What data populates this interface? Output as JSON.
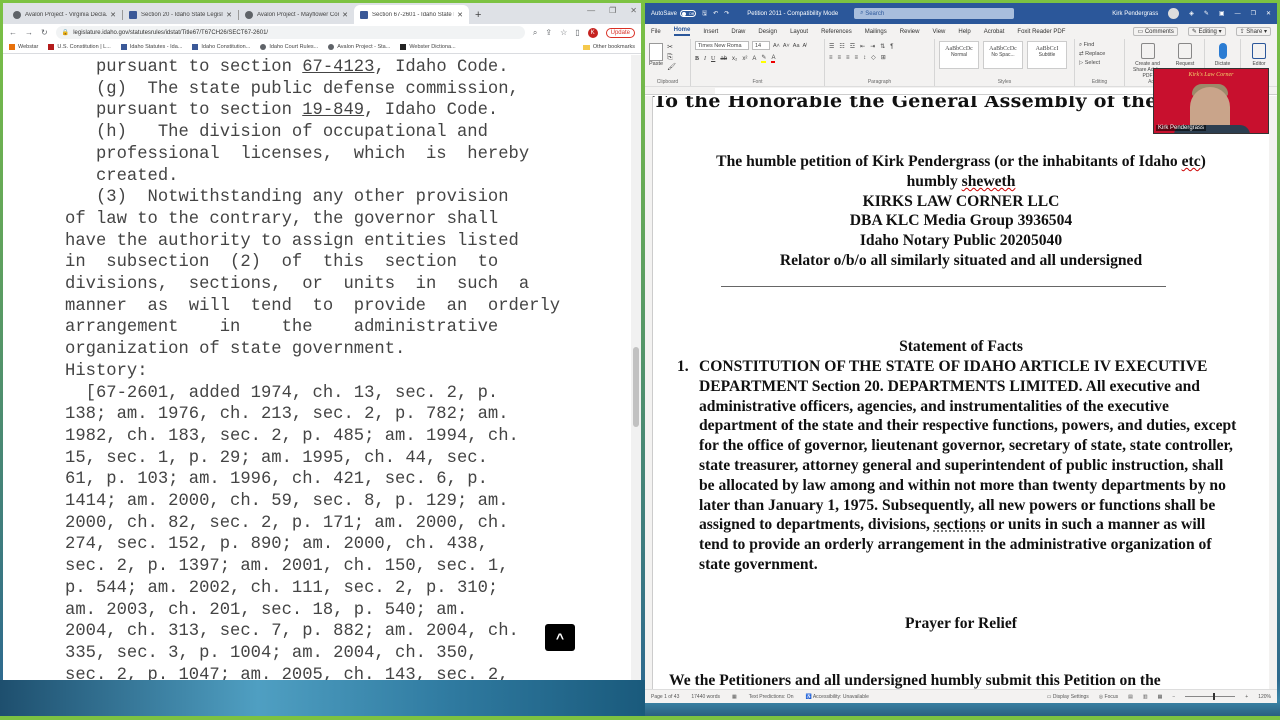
{
  "browser": {
    "tabs": [
      {
        "title": "Avalon Project - Virginia Decla...",
        "active": false
      },
      {
        "title": "Section 20 - Idaho State Legisla...",
        "active": false
      },
      {
        "title": "Avalon Project - Mayflower Com...",
        "active": false
      },
      {
        "title": "Section 67-2601 - Idaho State Le...",
        "active": true
      }
    ],
    "new_tab_label": "+",
    "url": "legislature.idaho.gov/statutesrules/idstat/Title67/T67CH26/SECT67-2601/",
    "profile_initial": "K",
    "update_label": "Update",
    "bookmarks": [
      {
        "label": "Webstar"
      },
      {
        "label": "U.S. Constitution | L..."
      },
      {
        "label": "Idaho Statutes - Ida..."
      },
      {
        "label": "Idaho Constitution..."
      },
      {
        "label": "Idaho Court Rules..."
      },
      {
        "label": "Avalon Project - Sta..."
      },
      {
        "label": "Webster Dictiona..."
      }
    ],
    "other_bookmarks_label": "Other bookmarks",
    "page": {
      "lines": [
        {
          "indent": "   ",
          "pre": "pursuant to section ",
          "link": "67-4123",
          "post": ", Idaho Code."
        },
        {
          "indent": "   ",
          "pre": "(g)  The state public defense commission,",
          "link": "",
          "post": ""
        },
        {
          "indent": "   ",
          "pre": "pursuant to section ",
          "link": "19-849",
          "post": ", Idaho Code."
        },
        {
          "indent": "   ",
          "pre": "(h)   The division of occupational and",
          "link": "",
          "post": ""
        },
        {
          "indent": "   ",
          "pre": "professional  licenses,  which  is  hereby",
          "link": "",
          "post": ""
        },
        {
          "indent": "   ",
          "pre": "created.",
          "link": "",
          "post": ""
        },
        {
          "indent": "   ",
          "pre": "(3)  Notwithstanding any other provision",
          "link": "",
          "post": ""
        },
        {
          "indent": "",
          "pre": "of law to the contrary, the governor shall",
          "link": "",
          "post": ""
        },
        {
          "indent": "",
          "pre": "have the authority to assign entities listed",
          "link": "",
          "post": ""
        },
        {
          "indent": "",
          "pre": "in  subsection  (2)  of  this  section  to",
          "link": "",
          "post": ""
        },
        {
          "indent": "",
          "pre": "divisions,  sections,  or  units  in  such  a",
          "link": "",
          "post": ""
        },
        {
          "indent": "",
          "pre": "manner  as  will  tend  to  provide  an  orderly",
          "link": "",
          "post": ""
        },
        {
          "indent": "",
          "pre": "arrangement    in    the    administrative",
          "link": "",
          "post": ""
        },
        {
          "indent": "",
          "pre": "organization of state government.",
          "link": "",
          "post": ""
        },
        {
          "indent": "",
          "pre": "History:",
          "link": "",
          "post": ""
        },
        {
          "indent": "  ",
          "pre": "[67-2601, added 1974, ch. 13, sec. 2, p.",
          "link": "",
          "post": ""
        },
        {
          "indent": "",
          "pre": "138; am. 1976, ch. 213, sec. 2, p. 782; am.",
          "link": "",
          "post": ""
        },
        {
          "indent": "",
          "pre": "1982, ch. 183, sec. 2, p. 485; am. 1994, ch.",
          "link": "",
          "post": ""
        },
        {
          "indent": "",
          "pre": "15, sec. 1, p. 29; am. 1995, ch. 44, sec.",
          "link": "",
          "post": ""
        },
        {
          "indent": "",
          "pre": "61, p. 103; am. 1996, ch. 421, sec. 6, p.",
          "link": "",
          "post": ""
        },
        {
          "indent": "",
          "pre": "1414; am. 2000, ch. 59, sec. 8, p. 129; am.",
          "link": "",
          "post": ""
        },
        {
          "indent": "",
          "pre": "2000, ch. 82, sec. 2, p. 171; am. 2000, ch.",
          "link": "",
          "post": ""
        },
        {
          "indent": "",
          "pre": "274, sec. 152, p. 890; am. 2000, ch. 438,",
          "link": "",
          "post": ""
        },
        {
          "indent": "",
          "pre": "sec. 2, p. 1397; am. 2001, ch. 150, sec. 1,",
          "link": "",
          "post": ""
        },
        {
          "indent": "",
          "pre": "p. 544; am. 2002, ch. 111, sec. 2, p. 310;",
          "link": "",
          "post": ""
        },
        {
          "indent": "",
          "pre": "am. 2003, ch. 201, sec. 18, p. 540; am.",
          "link": "",
          "post": ""
        },
        {
          "indent": "",
          "pre": "2004, ch. 313, sec. 7, p. 882; am. 2004, ch.",
          "link": "",
          "post": ""
        },
        {
          "indent": "",
          "pre": "335, sec. 3, p. 1004; am. 2004, ch. 350,",
          "link": "",
          "post": ""
        },
        {
          "indent": "",
          "pre": "sec. 2, p. 1047; am. 2005, ch. 143, sec. 2,",
          "link": "",
          "post": ""
        }
      ],
      "back_to_top_icon": "^"
    }
  },
  "word": {
    "autosave_label": "AutoSave",
    "autosave_state": "Off",
    "doc_title": "Petition 2011 - Compatibility Mode",
    "search_placeholder": "Search",
    "user_name": "Kirk Pendergrass",
    "menu": [
      "File",
      "Home",
      "Insert",
      "Draw",
      "Design",
      "Layout",
      "References",
      "Mailings",
      "Review",
      "View",
      "Help",
      "Acrobat",
      "Foxit Reader PDF"
    ],
    "active_menu": "Home",
    "comments_label": "Comments",
    "editing_label": "Editing",
    "share_label": "Share",
    "ribbon": {
      "paste_label": "Paste",
      "clipboard_label": "Clipboard",
      "font_name": "Times New Roma",
      "font_size": "14",
      "font_label": "Font",
      "paragraph_label": "Paragraph",
      "styles": [
        {
          "preview": "AaBbCcDc",
          "name": "Normal"
        },
        {
          "preview": "AaBbCcDc",
          "name": "No Spac..."
        },
        {
          "preview": "AaBbCcI",
          "name": "Subtitle"
        }
      ],
      "styles_label": "Styles",
      "find_label": "Find",
      "replace_label": "Replace",
      "select_label": "Select",
      "editing_group_label": "Editing",
      "create_share_label": "Create and Share Adobe PDF",
      "request_label": "Request",
      "dictate_label": "Dictate",
      "editor_label": "Editor",
      "adobe_group_label": "Adobe Acrobat"
    },
    "document": {
      "heading": "To the Honorable the General Assembly of the State of",
      "petition_line1": "The humble petition of Kirk Pendergrass (or the inhabitants of Idaho ",
      "petition_etc": "etc",
      "petition_line1_end": ")",
      "humbly": "humbly ",
      "sheweth": "sheweth",
      "company": "KIRKS LAW CORNER LLC",
      "dba": "DBA KLC Media Group 3936504",
      "notary": "Idaho Notary Public 20205040",
      "relator": "Relator o/b/o all similarly situated and all undersigned",
      "statement_title": "Statement of Facts",
      "fact_number": "1.",
      "fact_text_before": "CONSTITUTION OF THE STATE OF IDAHO ARTICLE IV EXECUTIVE DEPARTMENT Section 20.  DEPARTMENTS LIMITED. All executive and administrative officers, agencies, and instrumentalities of the executive department of the state and their respective functions, powers, and duties, except for the office of governor, lieutenant governor, secretary of state, state controller, state treasurer, attorney general and superintendent of public instruction, shall be allocated by law among and within not more than twenty departments by no later than January 1, 1975. Subsequently, all new powers or functions shall be assigned to departments, divisions, ",
      "fact_sections": "sections",
      "fact_text_after": " or units in such a manner as will tend to provide an orderly arrangement in the administrative organization of state government.",
      "prayer_title": "Prayer for Relief",
      "cutoff_line": "We the Petitioners and all undersigned humbly submit this Petition on the"
    },
    "webcam_name": "Kirk Pendergrass",
    "webcam_banner": "Kirk's Law Corner",
    "status": {
      "page": "Page 1 of 43",
      "words": "17440 words",
      "text_predictions": "Text Predictions: On",
      "accessibility": "Accessibility: Unavailable",
      "display_settings": "Display Settings",
      "focus": "Focus",
      "zoom": "120%"
    }
  }
}
